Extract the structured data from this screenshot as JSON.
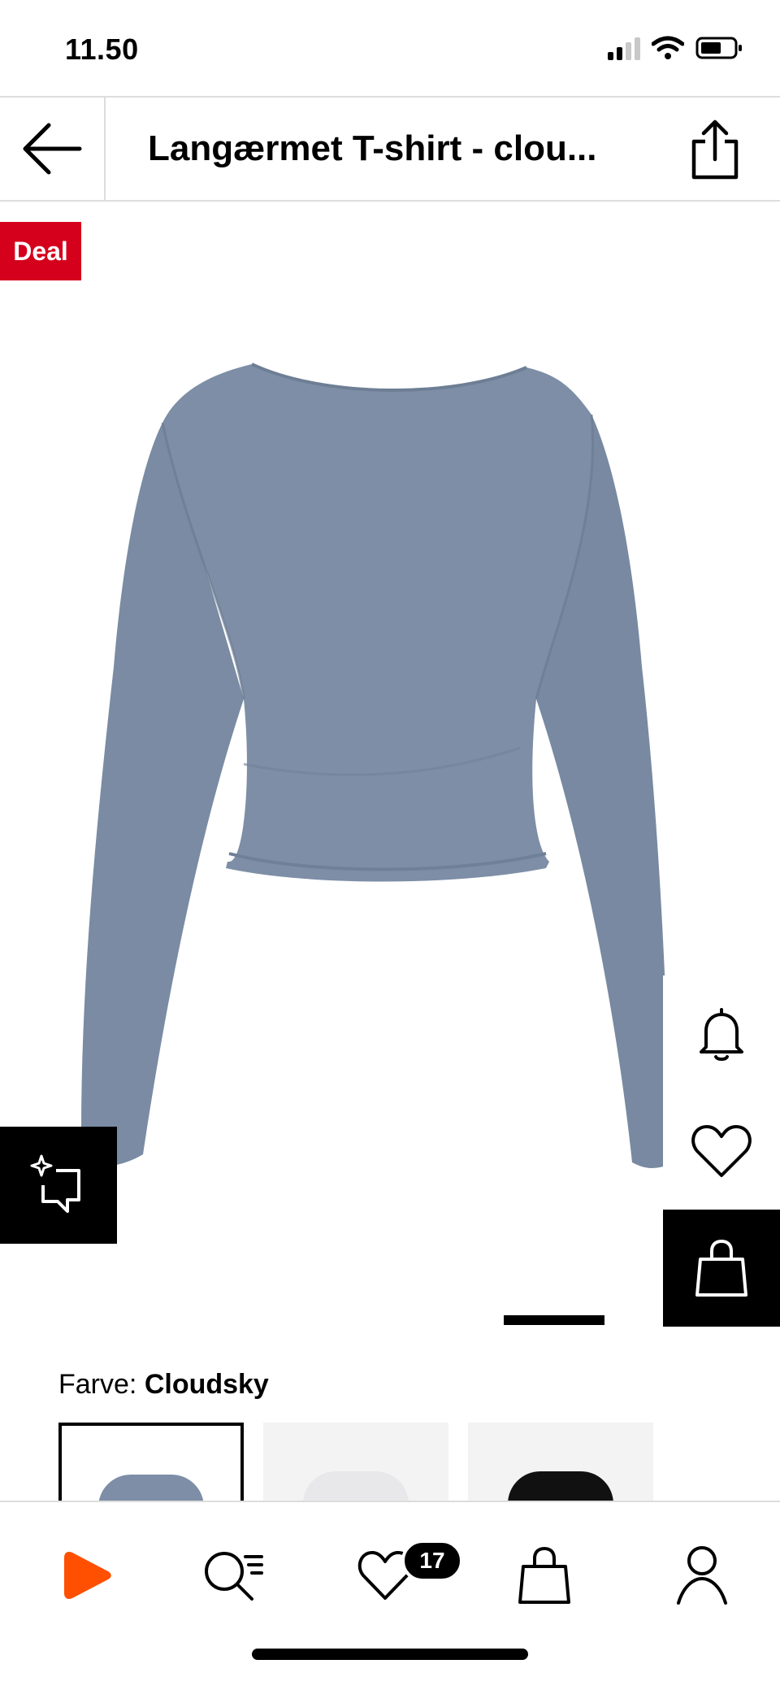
{
  "status_bar": {
    "time": "11.50"
  },
  "header": {
    "title": "Langærmet T-shirt - clou..."
  },
  "product": {
    "badge": "Deal",
    "color_prefix": "Farve:",
    "color_name": "Cloudsky",
    "product_color": "#7d8ea6",
    "swatches": [
      {
        "name": "Cloudsky",
        "color": "#7d8ea6",
        "selected": true
      },
      {
        "name": "White",
        "color": "#e8e8ea",
        "selected": false
      },
      {
        "name": "Black",
        "color": "#111111",
        "selected": false
      }
    ]
  },
  "tab_bar": {
    "wishlist_count": "17",
    "brand_color": "#ff4f00"
  },
  "icons": [
    "arrow-left-icon",
    "share-icon",
    "bell-icon",
    "heart-icon",
    "shopping-bag-icon",
    "sparkle-chat-icon",
    "search-list-icon",
    "user-icon"
  ]
}
